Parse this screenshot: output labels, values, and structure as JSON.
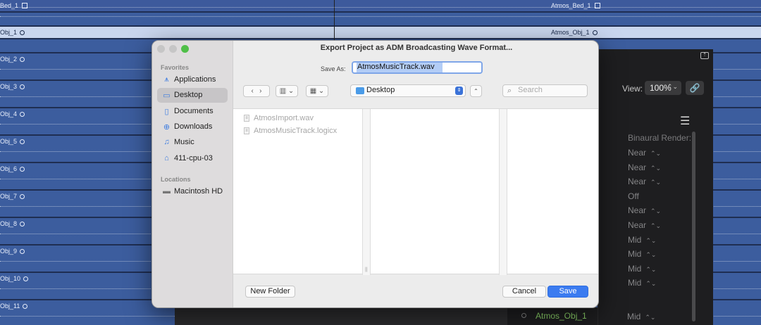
{
  "tracks": {
    "top": {
      "left_name": "Bed_1",
      "right_name": "Atmos_Bed_1"
    },
    "selected": {
      "left_name": "Obj_1",
      "right_name": "Atmos_Obj_1"
    },
    "rows": [
      "Obj_2",
      "Obj_3",
      "Obj_4",
      "Obj_5",
      "Obj_6",
      "Obj_7",
      "Obj_8",
      "Obj_9",
      "Obj_10",
      "Obj_11"
    ]
  },
  "right_panel": {
    "view_label": "View:",
    "zoom_value": "100%",
    "binaural_label": "Binaural Render:",
    "render_values": [
      "Near",
      "Near",
      "Near",
      "Off",
      "Near",
      "Near",
      "Mid",
      "Mid",
      "Mid",
      "Mid"
    ],
    "bottom_object_name": "Atmos_Obj_1",
    "bottom_object_render": "Mid"
  },
  "dialog": {
    "title": "Export Project as ADM Broadcasting Wave Format...",
    "save_as_label": "Save As:",
    "save_as_value": "AtmosMusicTrack.wav",
    "location": "Desktop",
    "search_placeholder": "Search",
    "sidebar": {
      "favorites_heading": "Favorites",
      "favorites": [
        {
          "label": "Applications",
          "icon": "applications-icon"
        },
        {
          "label": "Desktop",
          "icon": "desktop-icon",
          "active": true
        },
        {
          "label": "Documents",
          "icon": "documents-icon"
        },
        {
          "label": "Downloads",
          "icon": "downloads-icon"
        },
        {
          "label": "Music",
          "icon": "music-icon"
        },
        {
          "label": "411-cpu-03",
          "icon": "home-icon"
        }
      ],
      "locations_heading": "Locations",
      "locations": [
        {
          "label": "Macintosh HD",
          "icon": "hard-drive-icon"
        }
      ]
    },
    "files": [
      "AtmosImport.wav",
      "AtmosMusicTrack.logicx"
    ],
    "buttons": {
      "new_folder": "New Folder",
      "cancel": "Cancel",
      "save": "Save"
    }
  }
}
